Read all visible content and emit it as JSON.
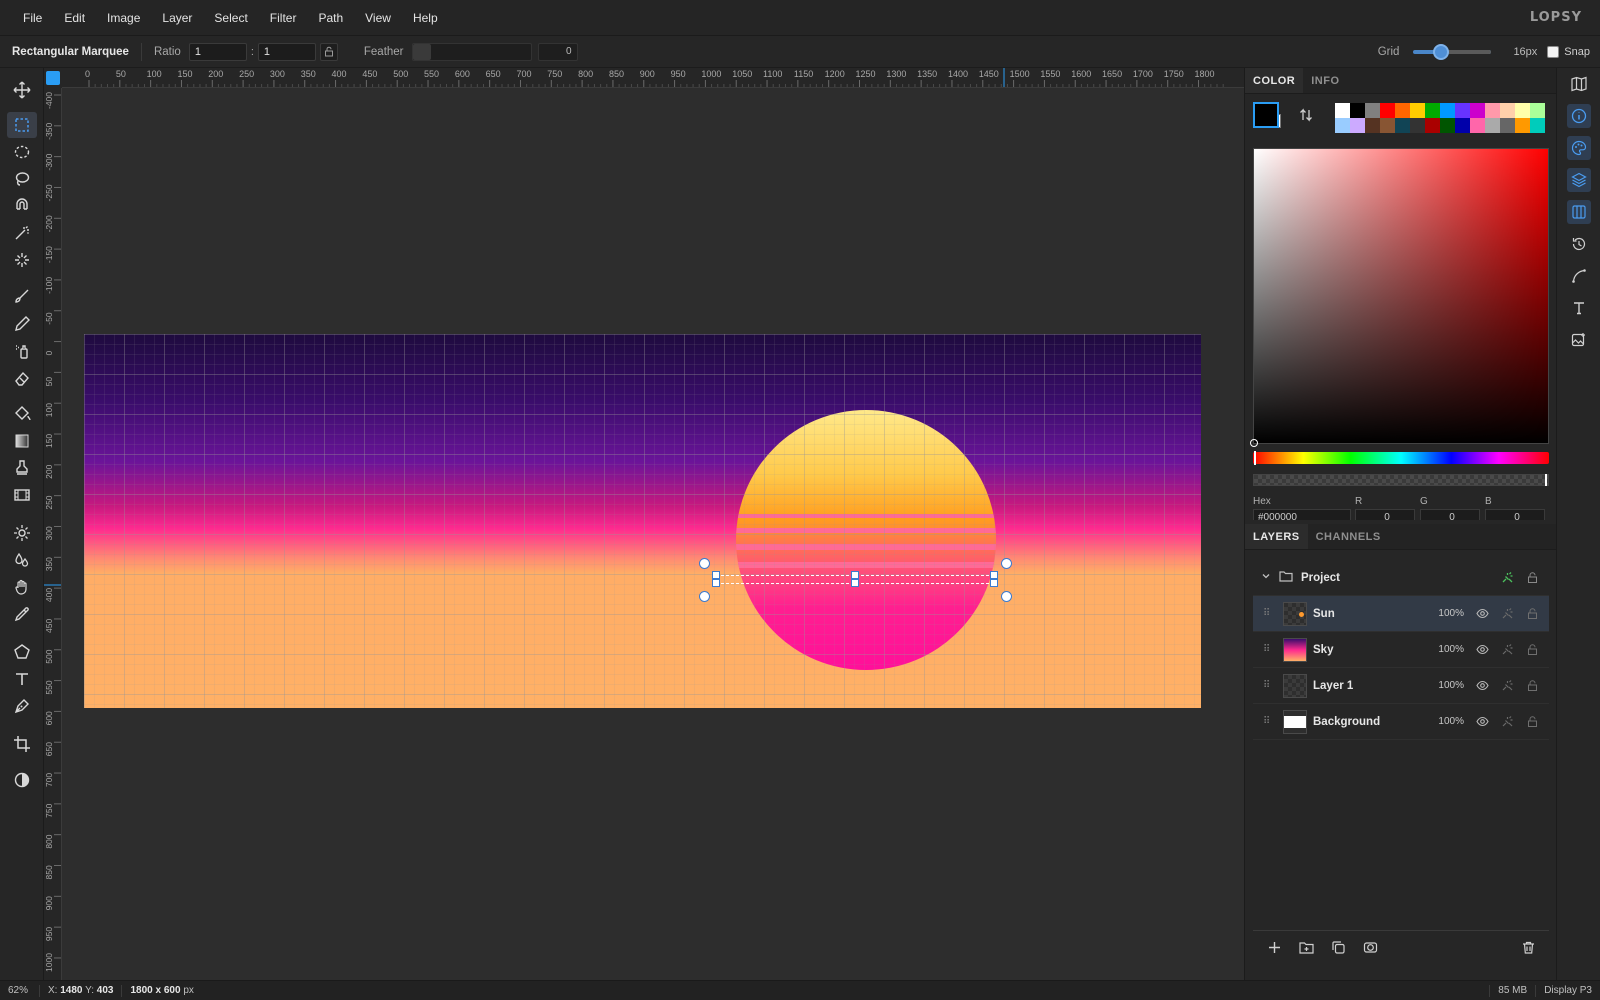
{
  "menu": [
    "File",
    "Edit",
    "Image",
    "Layer",
    "Select",
    "Filter",
    "Path",
    "View",
    "Help"
  ],
  "brand": "LOPSY",
  "options": {
    "tool_name": "Rectangular Marquee",
    "ratio_label": "Ratio",
    "ratio_w": "1",
    "ratio_h": "1",
    "colon": ":",
    "feather_label": "Feather",
    "feather_value": "0",
    "grid_label": "Grid",
    "grid_size": "16px",
    "snap_label": "Snap"
  },
  "ruler": {
    "top_ticks": [
      "0",
      "50",
      "100",
      "150",
      "200",
      "250",
      "300",
      "350",
      "400",
      "450",
      "500",
      "550",
      "600",
      "650",
      "700",
      "750",
      "800",
      "850",
      "900",
      "950",
      "1000",
      "1050",
      "1100",
      "1150",
      "1200",
      "1250",
      "1300",
      "1350",
      "1400",
      "1450",
      "1500",
      "1550",
      "1600",
      "1650",
      "1700",
      "1750",
      "1800"
    ],
    "left_ticks": [
      "-400",
      "-350",
      "-300",
      "-250",
      "-200",
      "-150",
      "-100",
      "-50",
      "0",
      "50",
      "100",
      "150",
      "200",
      "250",
      "300",
      "350",
      "400",
      "450",
      "500",
      "550",
      "600",
      "650",
      "700",
      "750",
      "800",
      "850",
      "900",
      "950",
      "1000"
    ]
  },
  "panel": {
    "color_tabs": [
      "COLOR",
      "INFO"
    ],
    "swatch_colors": [
      "#ffffff",
      "#000000",
      "#808080",
      "#ff0000",
      "#ff6600",
      "#ffcc00",
      "#00aa00",
      "#0099ff",
      "#6633ff",
      "#cc00cc",
      "#ff99aa",
      "#ffd0aa",
      "#ffffaa",
      "#aaff99",
      "#99ccff",
      "#ccaaff",
      "#553322",
      "#885533",
      "#114455",
      "#333333",
      "#aa0000",
      "#005500",
      "#0000aa",
      "#ff66aa",
      "#aaaaaa",
      "#666666",
      "#ff9900",
      "#00ccbb"
    ],
    "fields": {
      "hex_label": "Hex",
      "r_label": "R",
      "g_label": "G",
      "b_label": "B",
      "hex": "#000000",
      "r": "0",
      "g": "0",
      "b": "0"
    },
    "layer_tabs": [
      "LAYERS",
      "CHANNELS"
    ],
    "group_name": "Project",
    "layers": [
      {
        "name": "Sun",
        "opacity": "100%"
      },
      {
        "name": "Sky",
        "opacity": "100%"
      },
      {
        "name": "Layer 1",
        "opacity": "100%"
      },
      {
        "name": "Background",
        "opacity": "100%"
      }
    ]
  },
  "status": {
    "zoom": "62%",
    "x_label": "X:",
    "x_value": "1480",
    "y_label": "Y:",
    "y_value": "403",
    "doc_w": "1800",
    "x_sep": "x",
    "doc_h": "600",
    "doc_unit": "px",
    "memory": "85 MB",
    "profile": "Display P3"
  }
}
